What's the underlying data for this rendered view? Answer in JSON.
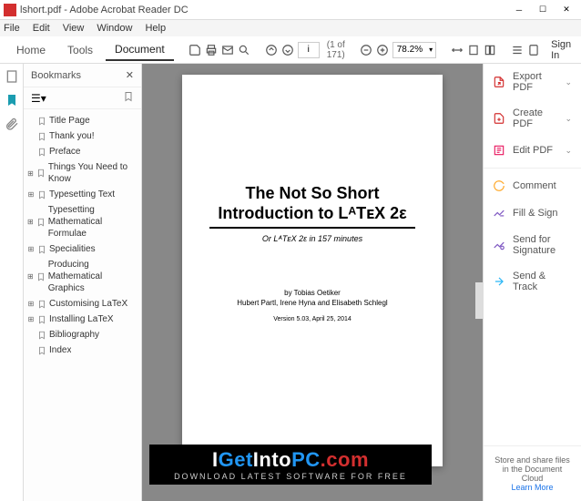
{
  "titlebar": {
    "title": "lshort.pdf - Adobe Acrobat Reader DC"
  },
  "menubar": [
    "File",
    "Edit",
    "View",
    "Window",
    "Help"
  ],
  "tabs": {
    "home": "Home",
    "tools": "Tools",
    "document": "Document"
  },
  "toolbar": {
    "page_value": "i",
    "page_count": "(1 of 171)",
    "zoom": "78.2%",
    "signin": "Sign In"
  },
  "bookmarks": {
    "title": "Bookmarks",
    "items": [
      {
        "label": "Title Page",
        "expand": false
      },
      {
        "label": "Thank you!",
        "expand": false
      },
      {
        "label": "Preface",
        "expand": false
      },
      {
        "label": "Things You Need to Know",
        "expand": true
      },
      {
        "label": "Typesetting Text",
        "expand": true
      },
      {
        "label": "Typesetting Mathematical Formulae",
        "expand": true
      },
      {
        "label": "Specialities",
        "expand": true
      },
      {
        "label": "Producing Mathematical Graphics",
        "expand": true
      },
      {
        "label": "Customising LaTeX",
        "expand": true
      },
      {
        "label": "Installing LaTeX",
        "expand": true
      },
      {
        "label": "Bibliography",
        "expand": false
      },
      {
        "label": "Index",
        "expand": false
      }
    ]
  },
  "document": {
    "title_line1": "The Not So Short",
    "title_line2": "Introduction to LᴬTᴇX 2ε",
    "subtitle": "Or LᴬTᴇX 2ε in 157 minutes",
    "author1": "by Tobias Oetiker",
    "author2": "Hubert Partl, Irene Hyna and Elisabeth Schlegl",
    "version": "Version 5.03, April 25, 2014"
  },
  "rightpanel": {
    "items": [
      {
        "label": "Export PDF",
        "color": "#d32f2f",
        "chevron": true
      },
      {
        "label": "Create PDF",
        "color": "#d32f2f",
        "chevron": true
      },
      {
        "label": "Edit PDF",
        "color": "#e91e63",
        "chevron": true
      },
      {
        "label": "Comment",
        "color": "#ffa726",
        "chevron": false
      },
      {
        "label": "Fill & Sign",
        "color": "#7e57c2",
        "chevron": false
      },
      {
        "label": "Send for Signature",
        "color": "#7e57c2",
        "chevron": false
      },
      {
        "label": "Send & Track",
        "color": "#29b6f6",
        "chevron": false
      }
    ],
    "footer_text": "Store and share files in the Document Cloud",
    "footer_link": "Learn More"
  },
  "watermark": {
    "text_i": "I",
    "text_get": "Get",
    "text_into": "Into",
    "text_pc": "PC",
    "text_com": ".com",
    "subtitle": "DOWNLOAD LATEST SOFTWARE FOR FREE"
  }
}
